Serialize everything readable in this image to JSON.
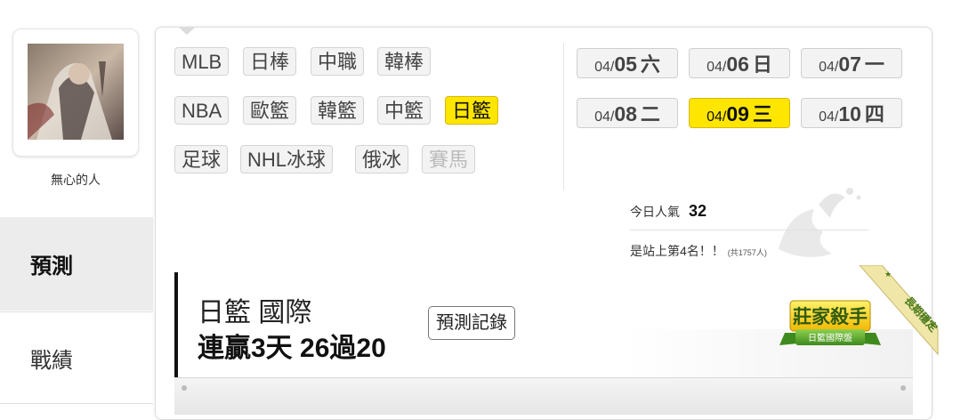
{
  "user": {
    "name": "無心的人"
  },
  "side_tabs": [
    {
      "label": "預測",
      "active": true
    },
    {
      "label": "戰績",
      "active": false
    }
  ],
  "sports": {
    "row1": [
      {
        "label": "MLB"
      },
      {
        "label": "日棒"
      },
      {
        "label": "中職"
      },
      {
        "label": "韓棒"
      }
    ],
    "row2": [
      {
        "label": "NBA"
      },
      {
        "label": "歐籃"
      },
      {
        "label": "韓籃"
      },
      {
        "label": "中籃"
      },
      {
        "label": "日籃",
        "active": true
      }
    ],
    "row3": [
      {
        "label": "足球"
      },
      {
        "label": "NHL冰球"
      },
      {
        "label": "俄冰"
      },
      {
        "label": "賽馬",
        "disabled": true
      }
    ]
  },
  "dates": [
    {
      "md": "04/",
      "day": "05",
      "weekday": "六"
    },
    {
      "md": "04/",
      "day": "06",
      "weekday": "日"
    },
    {
      "md": "04/",
      "day": "07",
      "weekday": "一"
    },
    {
      "md": "04/",
      "day": "08",
      "weekday": "二"
    },
    {
      "md": "04/",
      "day": "09",
      "weekday": "三",
      "active": true
    },
    {
      "md": "04/",
      "day": "10",
      "weekday": "四"
    }
  ],
  "popularity": {
    "label": "今日人氣",
    "value": "32",
    "rank_text": "是站上第4名！！",
    "total_text": "(共1757人)"
  },
  "record": {
    "title": "日籃 國際",
    "streak": "連贏3天 26過20",
    "button_label": "預測記錄"
  },
  "badge": {
    "ribbon": "長期穩定",
    "title": "莊家殺手",
    "subtitle": "日籃國際盤"
  },
  "colors": {
    "accent": "#ffe600",
    "badge_green": "#5aa02c",
    "badge_ribbon": "#efe6a8"
  }
}
